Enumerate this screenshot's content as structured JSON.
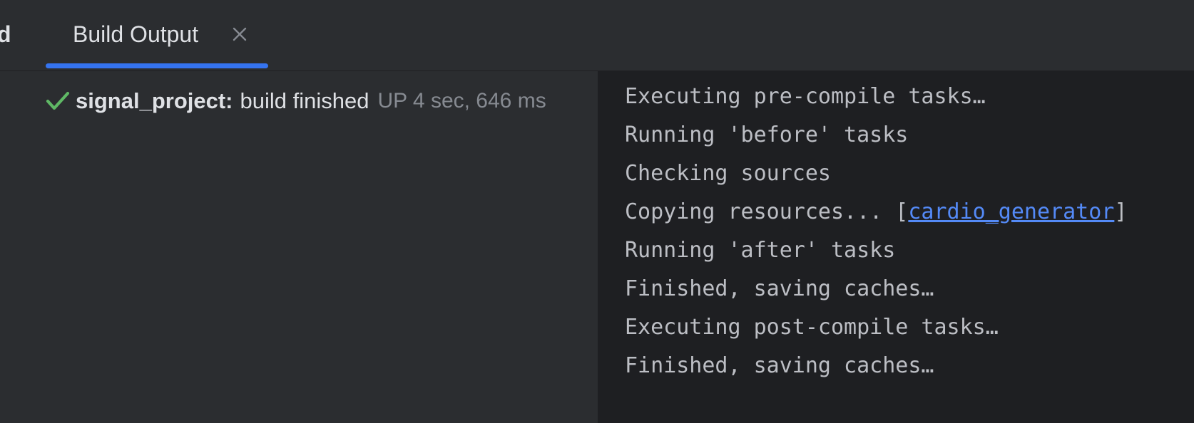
{
  "tabs": {
    "previous_tab_fragment": "d",
    "active": {
      "label": "Build Output",
      "close_icon": "close-icon"
    },
    "accent_color": "#3574f0"
  },
  "build_tree": {
    "rows": [
      {
        "icon": "checkmark-icon",
        "icon_color": "#5fb865",
        "project": "signal_project:",
        "status": "build finished",
        "time": "UP 4 sec, 646 ms"
      }
    ]
  },
  "console": {
    "lines": [
      {
        "text": "Executing pre-compile tasks…"
      },
      {
        "text": "Running 'before' tasks"
      },
      {
        "text": "Checking sources"
      },
      {
        "prefix": "Copying resources... [",
        "link": "cardio_generator",
        "suffix": "]"
      },
      {
        "text": "Running 'after' tasks"
      },
      {
        "text": "Finished, saving caches…"
      },
      {
        "text": "Executing post-compile tasks…"
      },
      {
        "text": "Finished, saving caches…"
      }
    ],
    "link_color": "#548af7"
  }
}
